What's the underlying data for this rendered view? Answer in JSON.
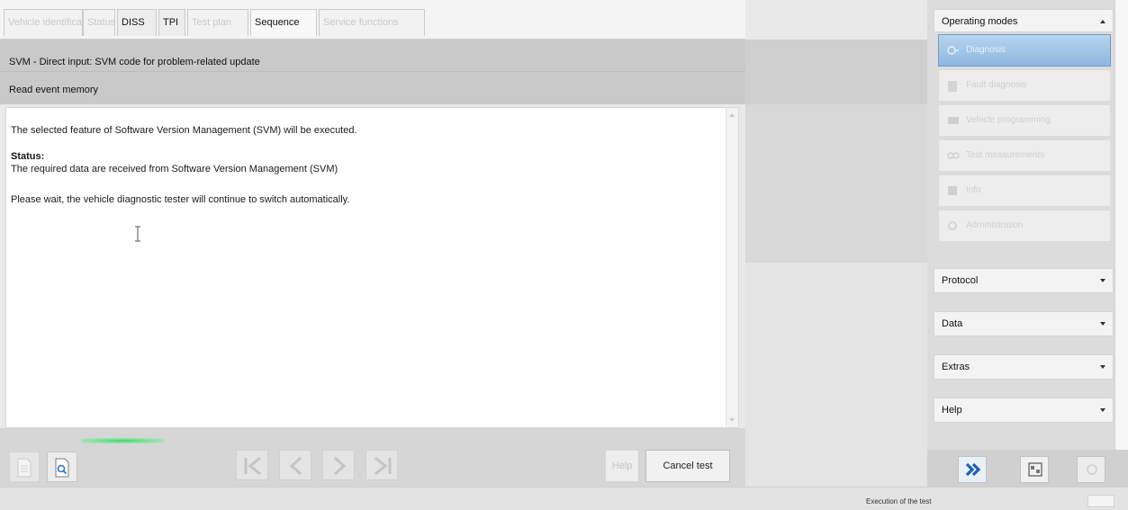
{
  "tabs": [
    {
      "label": "Vehicle identification",
      "state": "disabled"
    },
    {
      "label": "Status",
      "state": "disabled"
    },
    {
      "label": "DISS",
      "state": "normal"
    },
    {
      "label": "TPI",
      "state": "normal"
    },
    {
      "label": "Test plan",
      "state": "disabled"
    },
    {
      "label": "Sequence",
      "state": "active"
    },
    {
      "label": "Service functions",
      "state": "disabled"
    }
  ],
  "header": {
    "line1": "SVM - Direct input: SVM code for problem-related update",
    "line2": "Read event memory"
  },
  "content": {
    "message": "The selected feature of Software Version Management (SVM) will be executed.",
    "status_label": "Status:",
    "status_text": "The required data are received from Software Version Management (SVM)",
    "wait_text": "Please wait, the vehicle diagnostic tester will continue to switch automatically."
  },
  "progress": {
    "indeterminate": true,
    "color": "#3fd36a"
  },
  "bottom": {
    "help_label": "Help",
    "cancel_label": "Cancel test"
  },
  "sidebar": {
    "operating_modes": "Operating modes",
    "modes": [
      {
        "label": "Diagnosis",
        "icon": "diagnosis-icon",
        "selected": true
      },
      {
        "label": "Fault diagnosis",
        "icon": "fault-diagnosis-icon",
        "selected": false
      },
      {
        "label": "Vehicle programming",
        "icon": "programming-icon",
        "selected": false
      },
      {
        "label": "Test measurements",
        "icon": "measurement-icon",
        "selected": false
      },
      {
        "label": "Info",
        "icon": "info-icon",
        "selected": false
      },
      {
        "label": "Administration",
        "icon": "admin-icon",
        "selected": false
      }
    ],
    "sections": [
      {
        "label": "Protocol"
      },
      {
        "label": "Data"
      },
      {
        "label": "Extras"
      },
      {
        "label": "Help"
      }
    ]
  },
  "statusbar": {
    "text": "Execution of the test"
  },
  "colors": {
    "selected_mode": "#8db8e0",
    "accent_blue": "#1f5fb8",
    "progress_green": "#3fd36a"
  }
}
